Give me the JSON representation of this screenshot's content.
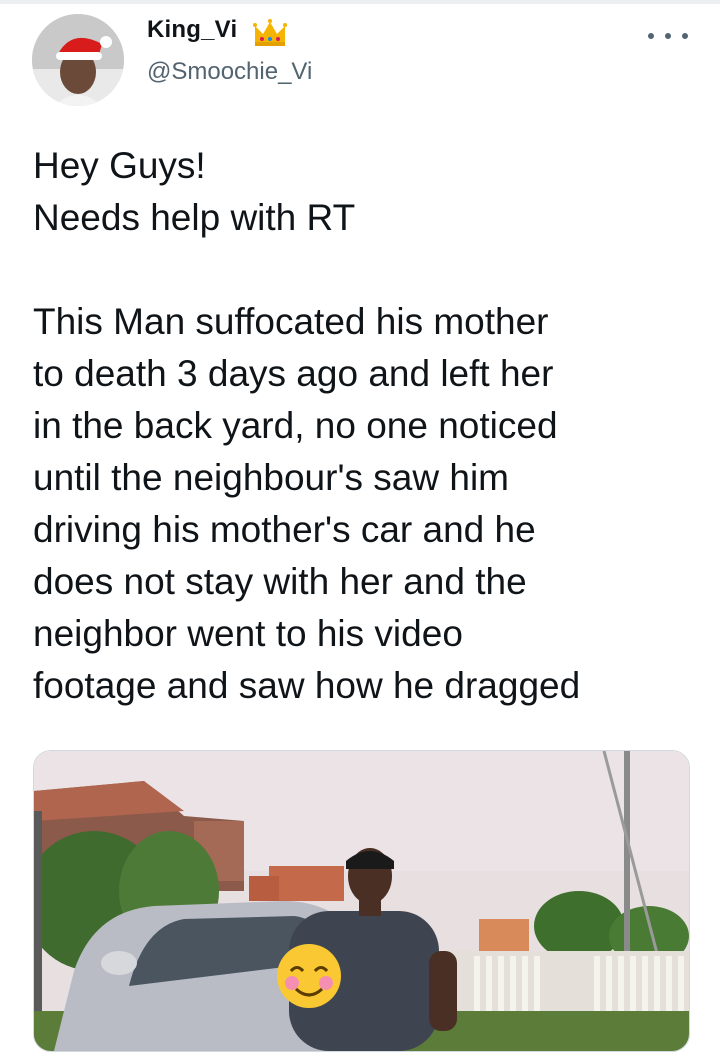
{
  "tweet": {
    "author": {
      "display_name": "King_Vi",
      "handle": "@Smoochie_Vi",
      "badge_icon": "crown-icon",
      "avatar_icon": "avatar"
    },
    "more_icon": "more-dots-icon",
    "text_lines": [
      "Hey Guys!",
      "Needs help with RT",
      "",
      "This Man suffocated his mother",
      "to death 3 days ago and left her",
      "in the back yard,  no one noticed",
      "until the neighbour's saw him",
      "driving his mother's car and he",
      "does not stay with her and the",
      "neighbor went to his video",
      "footage and saw how he dragged"
    ],
    "media_icon": "photo-man-with-car",
    "colors": {
      "text": "#0f1419",
      "secondary_text": "#536471",
      "crown": "#f5b400"
    }
  }
}
